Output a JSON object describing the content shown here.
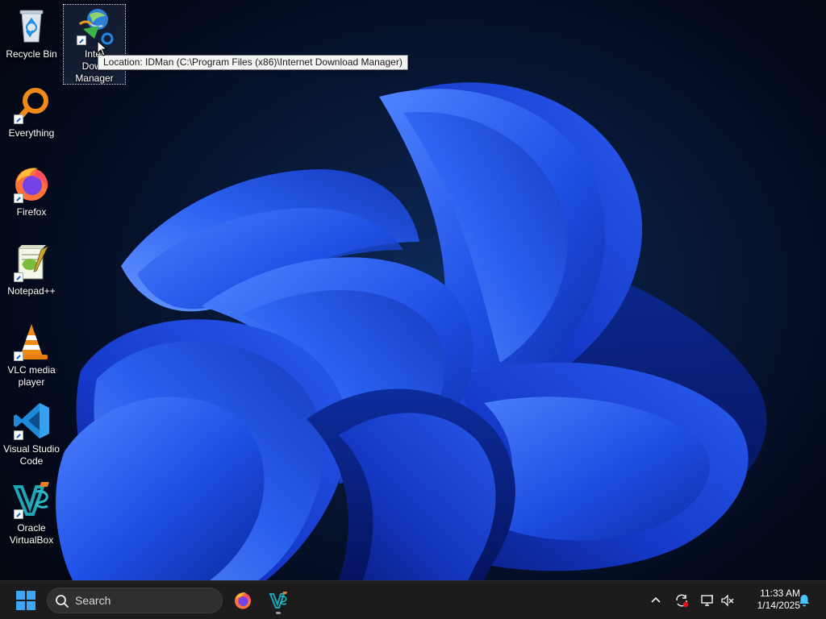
{
  "desktop": {
    "icons": [
      {
        "label": "Recycle Bin"
      },
      {
        "label": "Internet Download Manager",
        "label_visible": "Inter­t Down­ Manager"
      },
      {
        "label": "Everything"
      },
      {
        "label": "Firefox"
      },
      {
        "label": "Notepad++"
      },
      {
        "label": "VLC media player"
      },
      {
        "label": "Visual Studio Code"
      },
      {
        "label": "Oracle VirtualBox"
      }
    ],
    "idm_label_lines": [
      "Inter",
      "Down",
      "Manager"
    ],
    "tooltip": "Location: IDMan (C:\\Program Files (x86)\\Internet Download Manager)"
  },
  "taskbar": {
    "search_placeholder": "Search",
    "pinned_apps": [
      {
        "name": "Firefox",
        "icon": "firefox-icon"
      },
      {
        "name": "Oracle VirtualBox",
        "icon": "virtualbox-icon",
        "running": true
      }
    ],
    "tray": {
      "icons": [
        "chevron-up-icon",
        "sync-icon",
        "network-icon",
        "volume-muted-icon",
        "notification-bell-icon"
      ],
      "time": "11:33 AM",
      "date": "1/14/2025"
    }
  },
  "colors": {
    "taskbar_bg": "#1c1c1c",
    "accent": "#0078d4",
    "wallpaper_bloom": "#1f4fe0"
  }
}
